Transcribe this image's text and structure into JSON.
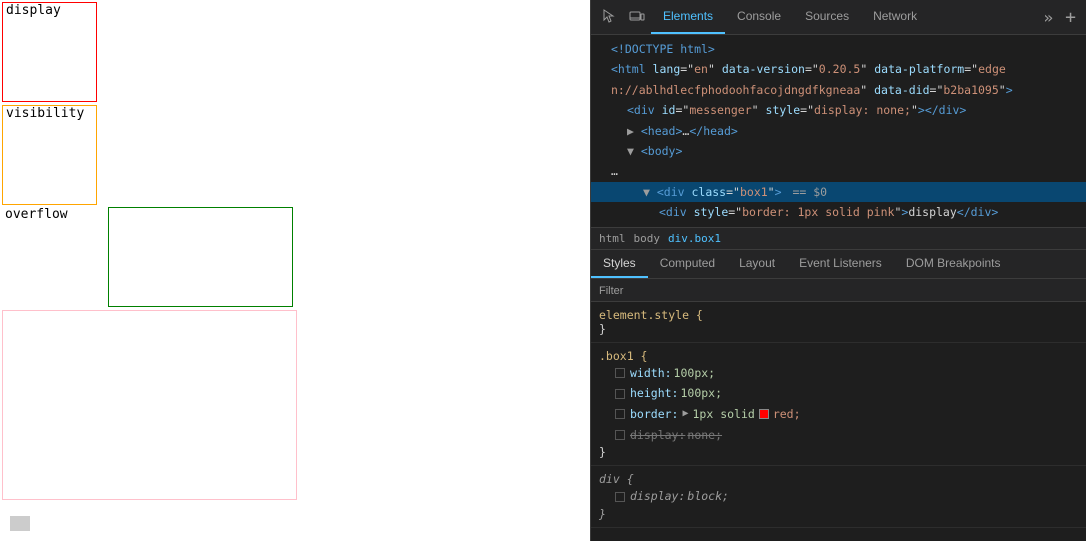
{
  "left_panel": {
    "demo_boxes": [
      {
        "label": "display",
        "type": "display"
      },
      {
        "label": "visibility",
        "type": "visibility"
      },
      {
        "label": "overflow",
        "type": "overflow"
      }
    ]
  },
  "devtools": {
    "toolbar": {
      "inspect_icon": "⬚",
      "device_icon": "⬜",
      "more_icon": "»",
      "add_icon": "+"
    },
    "tabs": [
      {
        "label": "Elements",
        "active": true
      },
      {
        "label": "Console",
        "active": false
      },
      {
        "label": "Sources",
        "active": false
      },
      {
        "label": "Network",
        "active": false
      }
    ],
    "dom_tree": {
      "lines": [
        {
          "text": "<!DOCTYPE html>",
          "indent": 1,
          "type": "doctype"
        },
        {
          "text": "<html lang=\"en\" data-version=\"0.20.5\" data-platform=\"edge",
          "indent": 1,
          "type": "tag-open"
        },
        {
          "text": "n://ablhdlecfphodoohfacojdngdfkgneaa\" data-did=\"b2ba1095\">",
          "indent": 1,
          "type": "tag-cont"
        },
        {
          "text": "<div id=\"messenger\" style=\"display: none;\"></div>",
          "indent": 2,
          "type": "tag"
        },
        {
          "text": "▶ <head>…</head>",
          "indent": 2,
          "type": "tag-collapsed"
        },
        {
          "text": "▼ <body>",
          "indent": 2,
          "type": "tag-open-arrow"
        },
        {
          "text": "…",
          "indent": 1,
          "type": "dots"
        },
        {
          "text": "▼ <div class=\"box1\"> == $0",
          "indent": 3,
          "type": "tag-selected",
          "selected": true
        },
        {
          "text": "<div style=\"border: 1px solid pink\">display</div>",
          "indent": 4,
          "type": "tag"
        }
      ]
    },
    "breadcrumb": {
      "items": [
        {
          "label": "html"
        },
        {
          "label": "body"
        },
        {
          "label": "div.box1",
          "active": true
        }
      ]
    },
    "panel_tabs": [
      {
        "label": "Styles",
        "active": true
      },
      {
        "label": "Computed",
        "active": false
      },
      {
        "label": "Layout",
        "active": false
      },
      {
        "label": "Event Listeners",
        "active": false
      },
      {
        "label": "DOM Breakpoints",
        "active": false
      }
    ],
    "filter_label": "Filter",
    "css_rules": [
      {
        "selector": "element.style {",
        "close": "}",
        "properties": []
      },
      {
        "selector": ".box1 {",
        "close": "}",
        "properties": [
          {
            "name": "width:",
            "value": "100px;",
            "type": "normal",
            "checkbox": false
          },
          {
            "name": "height:",
            "value": "100px;",
            "type": "normal",
            "checkbox": false
          },
          {
            "name": "border:",
            "value": "1px solid",
            "value2": "red;",
            "type": "color",
            "checkbox": false
          },
          {
            "name": "display:",
            "value": "none;",
            "type": "strike",
            "checkbox": true,
            "checked": false
          }
        ]
      },
      {
        "selector": "div {",
        "close": "}",
        "italic": true,
        "properties": [
          {
            "name": "display:",
            "value": "block;",
            "type": "normal",
            "italic": true
          }
        ]
      }
    ]
  }
}
